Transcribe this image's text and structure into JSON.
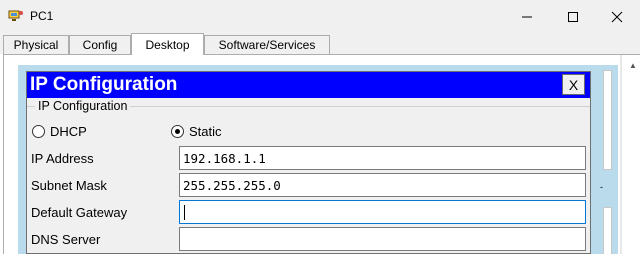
{
  "window": {
    "title": "PC1",
    "minimize_symbol": "—",
    "maximize_symbol": "☐",
    "close_symbol": "✕"
  },
  "tabs": [
    {
      "label": "Physical",
      "active": false
    },
    {
      "label": "Config",
      "active": false
    },
    {
      "label": "Desktop",
      "active": true
    },
    {
      "label": "Software/Services",
      "active": false
    }
  ],
  "ip_config": {
    "title": "IP Configuration",
    "close_label": "X",
    "group_label": "IP Configuration",
    "mode_options": [
      {
        "label": "DHCP",
        "selected": false
      },
      {
        "label": "Static",
        "selected": true
      }
    ],
    "fields": [
      {
        "label": "IP Address",
        "value": "192.168.1.1"
      },
      {
        "label": "Subnet Mask",
        "value": "255.255.255.0"
      },
      {
        "label": "Default Gateway",
        "value": ""
      },
      {
        "label": "DNS Server",
        "value": ""
      }
    ]
  },
  "colors": {
    "title_bar": "#0000ff",
    "desktop_background": "#b9dbeb",
    "focus_border": "#0078d7"
  },
  "icons": {
    "app": "packet-tracer-pc-icon",
    "scroll": "chevron-up-icon"
  }
}
